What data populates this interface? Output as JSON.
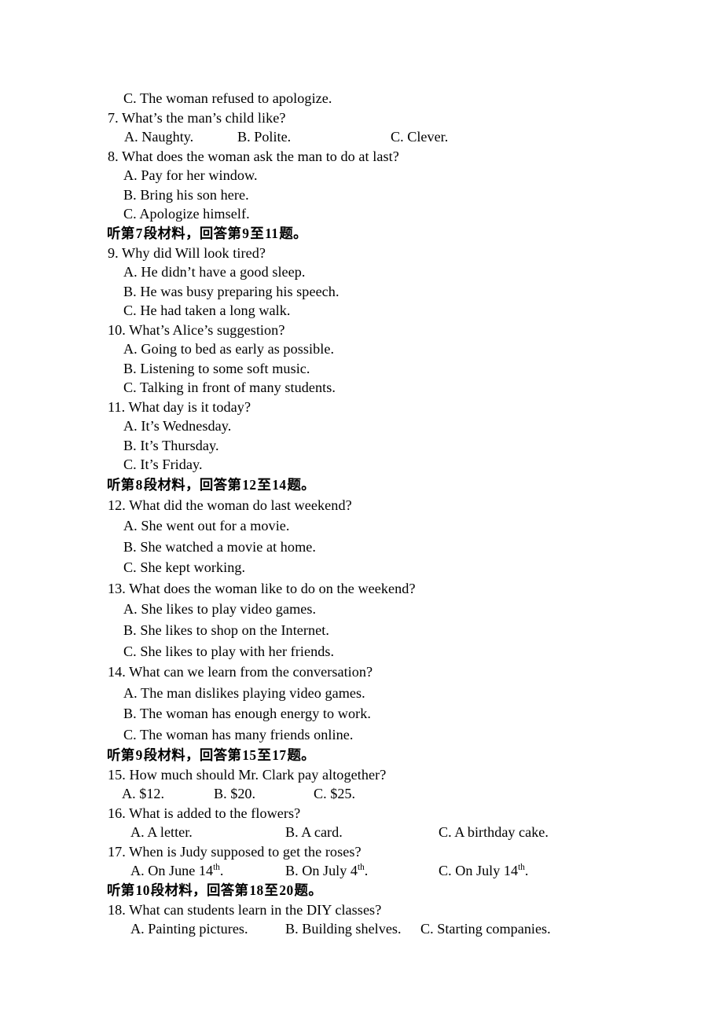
{
  "document": {
    "kind": "english-listening-comprehension-exam-page",
    "language": "en-zh"
  },
  "lines": {
    "q6_option_c": "C. The woman refused to apologize.",
    "q7_stem": "7. What’s the man’s child like?",
    "q7_a": "A. Naughty.",
    "q7_b": "B. Polite.",
    "q7_c": "C. Clever.",
    "q8_stem": "8. What does the woman ask the man to do at last?",
    "q8_a": "A. Pay for her window.",
    "q8_b": "B. Bring his son here.",
    "q8_c": "C. Apologize himself.",
    "q9_stem": "9. Why did Will look tired?",
    "q9_a": "A. He didn’t have a good sleep.",
    "q9_b": "B. He was busy preparing his speech.",
    "q9_c": "C. He had taken a long walk.",
    "q10_stem": "10. What’s Alice’s suggestion?",
    "q10_a": "A. Going to bed as early as possible.",
    "q10_b": "B. Listening to some soft music.",
    "q10_c": "C. Talking in front of many students.",
    "q11_stem": "11. What day is it today?",
    "q11_a": "A. It’s Wednesday.",
    "q11_b": "B. It’s Thursday.",
    "q11_c": "C. It’s Friday.",
    "q12_stem": "12. What did the woman do last weekend?",
    "q12_a": "A. She went out for a movie.",
    "q12_b": "B. She watched a movie at home.",
    "q12_c": "C. She kept working.",
    "q13_stem": "13. What does the woman like to do on the weekend?",
    "q13_a": "A. She likes to play video games.",
    "q13_b": "B. She likes to shop on the Internet.",
    "q13_c": "C. She likes to play with her friends.",
    "q14_stem": "14. What can we learn from the conversation?",
    "q14_a": "A. The man dislikes playing video games.",
    "q14_b": "B. The woman has enough energy to work.",
    "q14_c": "C. The woman has many friends online.",
    "q15_stem": "15. How much should Mr. Clark pay altogether?",
    "q15_a": "A. $12.",
    "q15_b": "B. $20.",
    "q15_c": "C. $25.",
    "q16_stem": "16. What is added to the flowers?",
    "q16_a": "A. A letter.",
    "q16_b": "B. A card.",
    "q16_c": "C. A birthday cake.",
    "q17_stem": "17. When is Judy supposed to get the roses?",
    "q17_a_pre": "A. On June 14",
    "q17_a_sup": "th",
    "q17_a_post": ".",
    "q17_b_pre": "B. On July 4",
    "q17_b_sup": "th",
    "q17_b_post": ".",
    "q17_c_pre": "C. On July 14",
    "q17_c_sup": "th",
    "q17_c_post": ".",
    "q18_stem": "18. What can students learn in the DIY classes?",
    "q18_a": "A. Painting pictures.",
    "q18_b": "B. Building shelves.",
    "q18_c": "C. Starting companies."
  },
  "section_headings": {
    "seg7": {
      "pre": "听第",
      "num": "7",
      "mid": "段材料，回答第",
      "from": "9",
      "to_word": "至",
      "to": "11",
      "post": "题。"
    },
    "seg8": {
      "pre": "听第",
      "num": "8",
      "mid": "段材料，回答第",
      "from": "12",
      "to_word": "至",
      "to": "14",
      "post": "题。"
    },
    "seg9": {
      "pre": "听第",
      "num": "9",
      "mid": "段材料，回答第",
      "from": "15",
      "to_word": "至",
      "to": "17",
      "post": "题。"
    },
    "seg10": {
      "pre": "听第",
      "num": "10",
      "mid": "段材料，回答第",
      "from": "18",
      "to_word": "至",
      "to": "20",
      "post": "题。"
    }
  },
  "colors": {
    "page_background": "#ffffff",
    "text": "#000000"
  }
}
